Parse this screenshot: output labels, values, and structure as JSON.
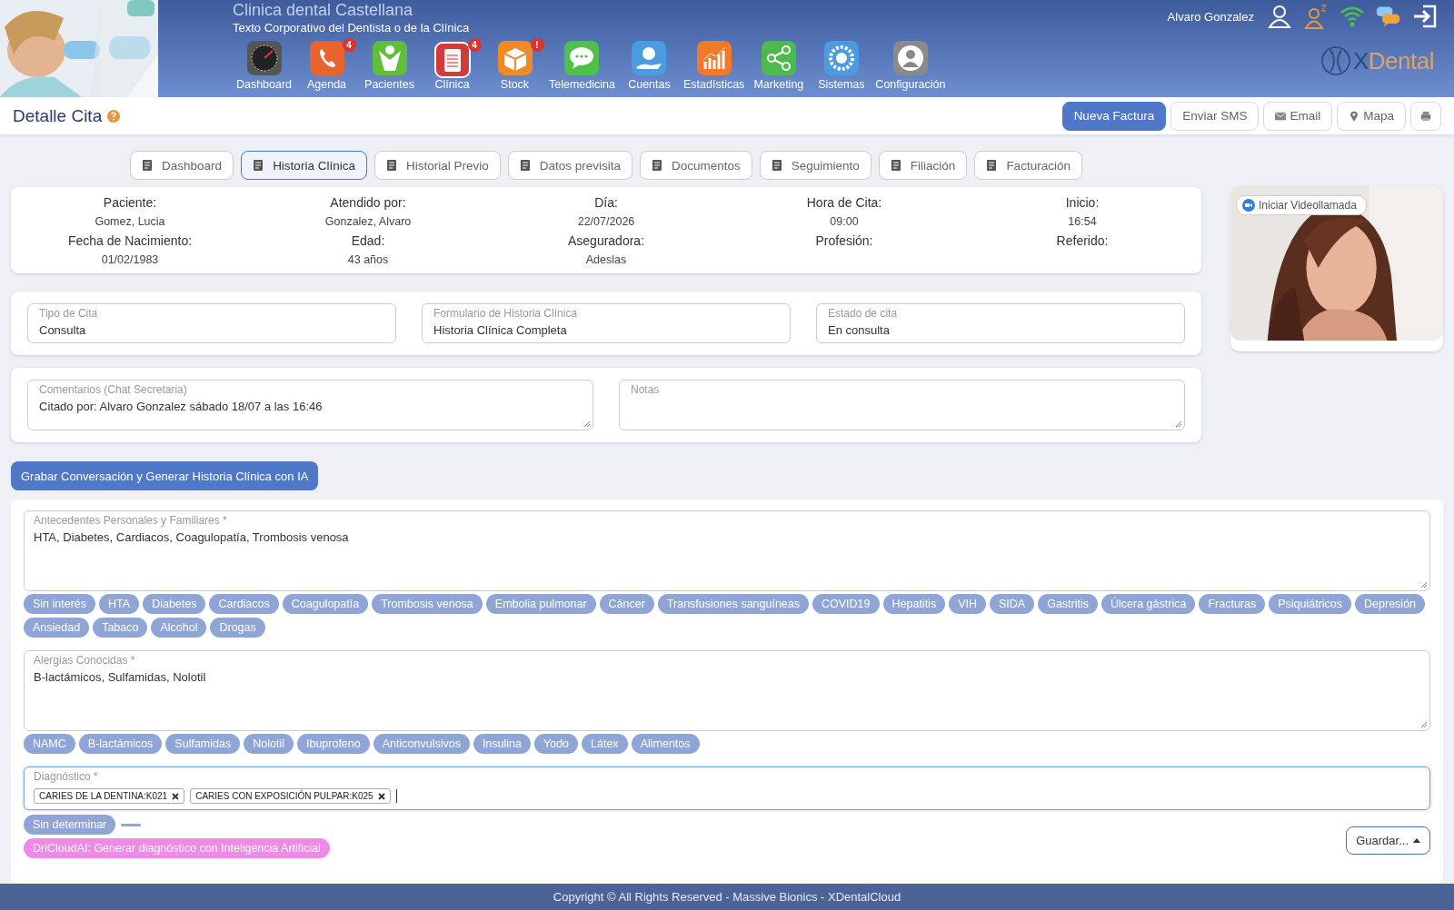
{
  "header": {
    "clinic_name": "Clinica dental Castellana",
    "tagline": "Texto Corporativo del Dentista o de la Clínica",
    "user_name": "Alvaro Gonzalez",
    "logo": {
      "mark": "X",
      "name": "Dental"
    },
    "nav": [
      {
        "label": "Dashboard",
        "kind": "gauge",
        "selected": false
      },
      {
        "label": "Agenda",
        "kind": "phone",
        "badge": "4",
        "selected": false
      },
      {
        "label": "Pacientes",
        "kind": "person",
        "selected": false
      },
      {
        "label": "Clínica",
        "kind": "clipboard",
        "badge": "4",
        "selected": true
      },
      {
        "label": "Stock",
        "kind": "box",
        "badge": "!",
        "selected": false
      },
      {
        "label": "Telemedicina",
        "kind": "chat",
        "selected": false
      },
      {
        "label": "Cuentas",
        "kind": "coin",
        "selected": false
      },
      {
        "label": "Estadísticas",
        "kind": "chart",
        "selected": false
      },
      {
        "label": "Marketing",
        "kind": "share",
        "selected": false
      },
      {
        "label": "Sistemas",
        "kind": "gear",
        "selected": false
      },
      {
        "label": "Configuración",
        "kind": "user",
        "selected": false
      }
    ]
  },
  "toolbar": {
    "title": "Detalle Cita",
    "actions": [
      {
        "label": "Nueva Factura",
        "kind": "primary"
      },
      {
        "label": "Enviar SMS",
        "kind": "plain"
      },
      {
        "label": "Email",
        "kind": "mail"
      },
      {
        "label": "Mapa",
        "kind": "pin"
      },
      {
        "kind": "print"
      }
    ]
  },
  "tabs": [
    {
      "label": "Dashboard",
      "selected": false
    },
    {
      "label": "Historia Clínica",
      "selected": true
    },
    {
      "label": "Historial Previo",
      "selected": false
    },
    {
      "label": "Datos previsita",
      "selected": false
    },
    {
      "label": "Documentos",
      "selected": false
    },
    {
      "label": "Seguimiento",
      "selected": false
    },
    {
      "label": "Filiación",
      "selected": false
    },
    {
      "label": "Facturación",
      "selected": false
    }
  ],
  "info": [
    {
      "label": "Paciente:",
      "value": "Gomez, Lucia"
    },
    {
      "label": "Atendido por:",
      "value": "Gonzalez, Alvaro"
    },
    {
      "label": "Día:",
      "value": "22/07/2026"
    },
    {
      "label": "Hora de Cita:",
      "value": "09:00"
    },
    {
      "label": "Inicio:",
      "value": "16:54"
    },
    {
      "label": "Fecha de Nacimiento:",
      "value": "01/02/1983"
    },
    {
      "label": "Edad:",
      "value": "43 años"
    },
    {
      "label": "Aseguradora:",
      "value": "Adeslas"
    },
    {
      "label": "Profesión:"
    },
    {
      "label": "Referido:"
    }
  ],
  "selects": [
    {
      "label": "Tipo de Cita",
      "value": "Consulta"
    },
    {
      "label": "Formulario de Historia Clínica",
      "value": "Historia Clínica Completa"
    },
    {
      "label": "Estado de cita",
      "value": "En consulta"
    }
  ],
  "notes": [
    {
      "label": "Comentarios (Chat Secretaria)",
      "value": "Citado por: Alvaro Gonzalez sábado 18/07 a las 16:46"
    },
    {
      "label": "Notas"
    }
  ],
  "record_button": "Grabar Conversación y Generar Historia Clínica con IA",
  "video_button": "Iniciar Videollamada",
  "antecedentes": {
    "label": "Antecedentes Personales y Familiares *",
    "value": "HTA, Diabetes, Cardiacos, Coagulopatía, Trombosis venosa",
    "chips": [
      "Sin interés",
      "HTA",
      "Diabetes",
      "Cardiacos",
      "Coagulopatía",
      "Trombosis venosa",
      "Embolia pulmonar",
      "Cáncer",
      "Transfusiones sanguíneas",
      "COVID19",
      "Hepatitis",
      "VIH",
      "SIDA",
      "Gastritis",
      "Úlcera gástrica",
      "Fracturas",
      "Psiquiátricos",
      "Depresión",
      "Ansiedad",
      "Tabaco",
      "Alcohol",
      "Drogas"
    ]
  },
  "alergias": {
    "label": "Alergias Conocidas *",
    "value": "B-lactámicos, Sulfamidas, Nolotil",
    "chips": [
      "NAMC",
      "B-lactámicos",
      "Sulfamidas",
      "Nolotil",
      "Ibuprofeno",
      "Anticonvulsivos",
      "Insulina",
      "Yodo",
      "Látex",
      "Alimentos"
    ]
  },
  "diagnostico": {
    "label": "Diagnóstico *",
    "tags": [
      "CARIES DE LA DENTINA:K021",
      "CARIES CON EXPOSICIÓN PULPAR:K025"
    ],
    "chip": "Sin determinar"
  },
  "ai_button": "DriCloudAI: Generar diagnóstico con Inteligencia Artificial",
  "save_button": "Guardar...",
  "footer": "Copyright © All Rights Reserved - Massive Bionics - XDentalCloud"
}
